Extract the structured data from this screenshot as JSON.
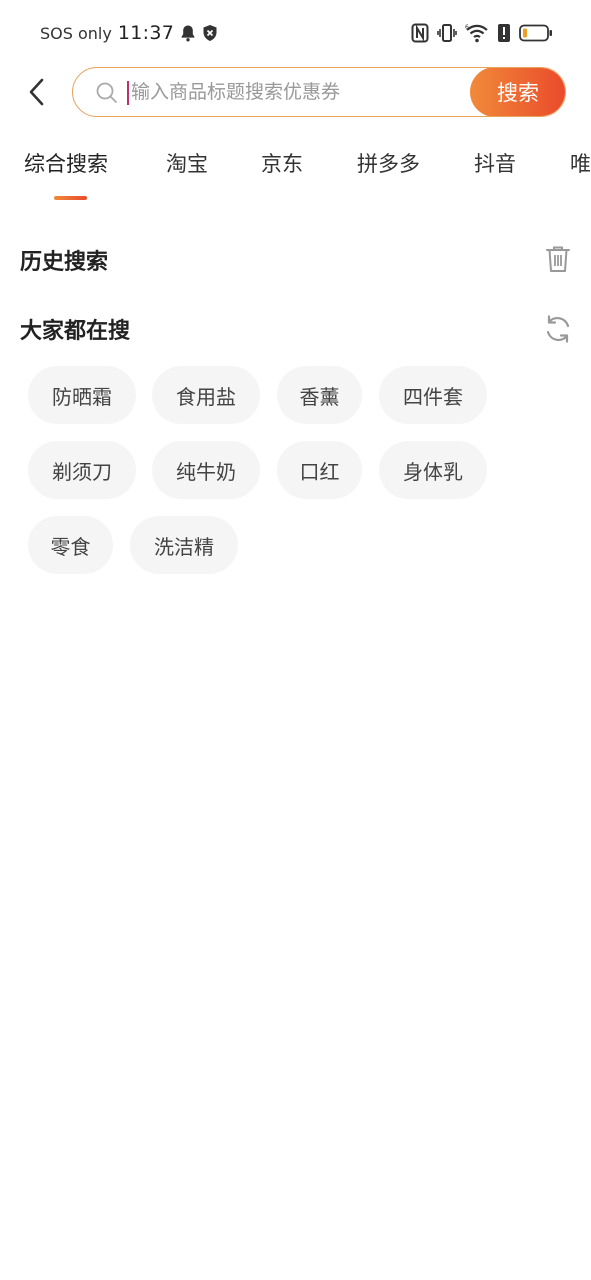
{
  "status_bar": {
    "carrier": "SOS only",
    "time": "11:37",
    "icons": [
      "bell-icon",
      "vpn-shield-icon",
      "nfc-icon",
      "vibrate-icon",
      "wifi-icon",
      "alert-icon",
      "battery-icon"
    ],
    "battery_color": "#f0a020"
  },
  "search": {
    "placeholder": "输入商品标题搜索优惠券",
    "value": "",
    "button_label": "搜索",
    "border_color": "#e8a25a",
    "button_gradient": [
      "#f08a3a",
      "#ea4a2b"
    ]
  },
  "tabs": [
    {
      "label": "综合搜索",
      "active": true
    },
    {
      "label": "淘宝",
      "active": false
    },
    {
      "label": "京东",
      "active": false
    },
    {
      "label": "拼多多",
      "active": false
    },
    {
      "label": "抖音",
      "active": false
    },
    {
      "label": "唯",
      "active": false
    }
  ],
  "history": {
    "title": "历史搜索",
    "action_icon": "trash-icon"
  },
  "trending": {
    "title": "大家都在搜",
    "action_icon": "refresh-icon",
    "items": [
      "防晒霜",
      "食用盐",
      "香薰",
      "四件套",
      "剃须刀",
      "纯牛奶",
      "口红",
      "身体乳",
      "零食",
      "洗洁精"
    ]
  }
}
